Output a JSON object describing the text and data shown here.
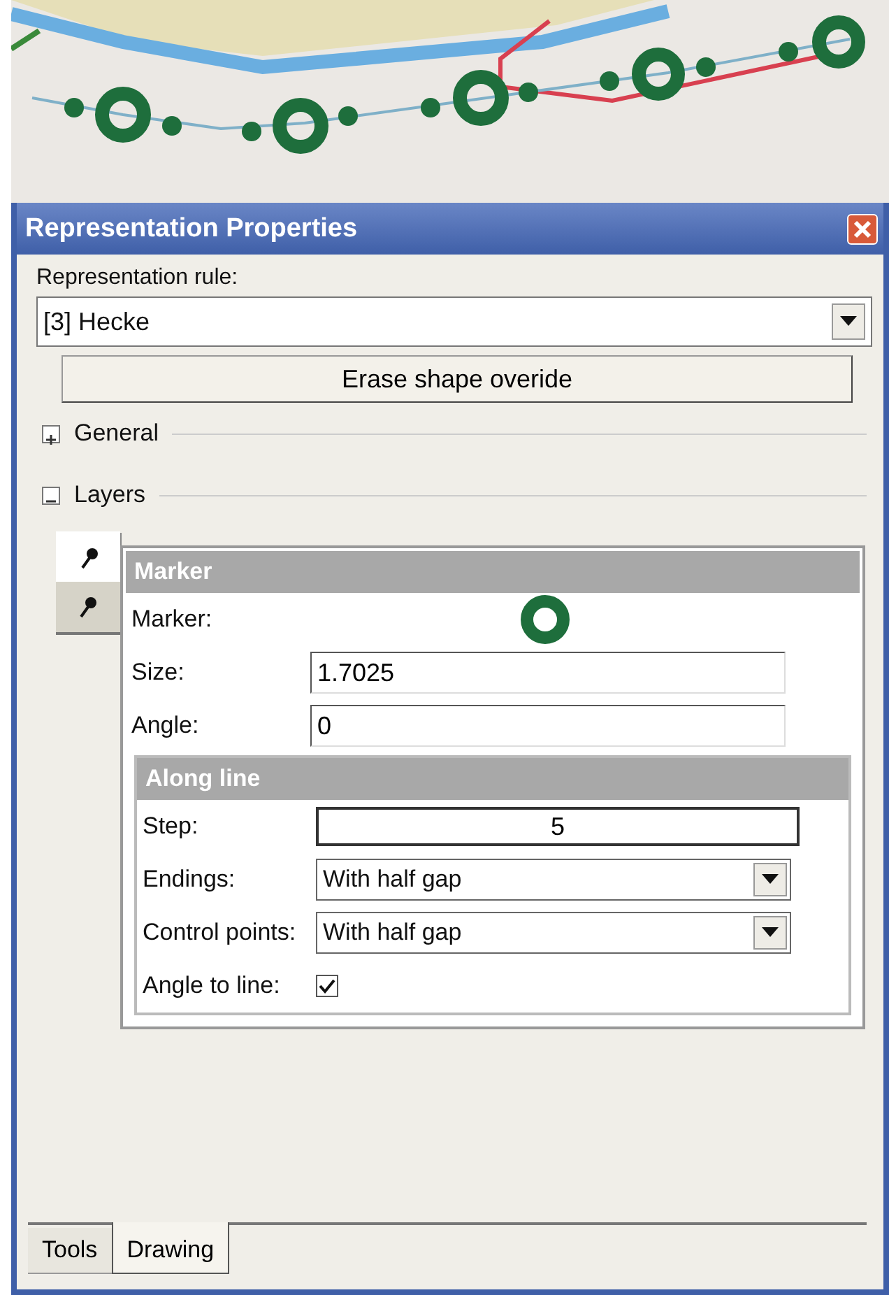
{
  "window": {
    "title": "Representation Properties"
  },
  "rule": {
    "label": "Representation rule:",
    "value": "[3] Hecke"
  },
  "erase_button": {
    "label": "Erase shape overide"
  },
  "sections": [
    {
      "label": "General",
      "expanded": false
    },
    {
      "label": "Layers",
      "expanded": true
    }
  ],
  "layer_tabs": [
    {
      "selected": true
    },
    {
      "selected": false
    }
  ],
  "marker": {
    "title": "Marker",
    "marker_label": "Marker:",
    "fields": [
      {
        "label": "Size:",
        "value": "1.7025"
      },
      {
        "label": "Angle:",
        "value": "0"
      }
    ]
  },
  "along_line": {
    "title": "Along line",
    "rows": [
      {
        "kind": "spin",
        "label": "Step:",
        "value": "5"
      },
      {
        "kind": "dropdown",
        "label": "Endings:",
        "value": "With half gap"
      },
      {
        "kind": "dropdown",
        "label": "Control points:",
        "value": "With half gap"
      },
      {
        "kind": "checkbox",
        "label": "Angle to line:",
        "checked": true
      }
    ]
  },
  "bottom_tabs": [
    {
      "label": "Tools",
      "selected": false
    },
    {
      "label": "Drawing",
      "selected": true
    }
  ]
}
